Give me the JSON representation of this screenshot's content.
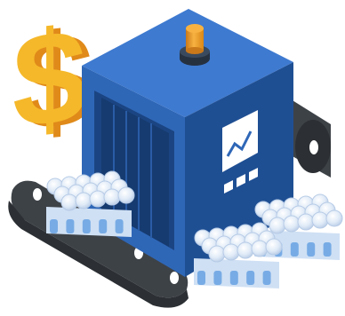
{
  "illustration": {
    "subject": "bottling-production-line",
    "icons": {
      "currency": "dollar-sign-icon",
      "beacon": "warning-beacon-icon",
      "screen": "line-chart-icon"
    },
    "colors": {
      "machine_front": "#2f67b7",
      "machine_side": "#1f4f93",
      "machine_top": "#3e7ad0",
      "belt": "#3d4247",
      "belt_dark": "#2c3034",
      "roller_hole": "#ffffff",
      "dollar_front": "#f5b82a",
      "dollar_side": "#e08a1a",
      "beacon_lamp": "#f0a22c",
      "beacon_base": "#263140",
      "bottle_cap": "#dfeaf7",
      "bottle_cap_edge": "#b7cbe6",
      "bottle_body": "#cfe0f4",
      "bottle_liquid": "#5a9ae0",
      "screen_bg": "#ffffff",
      "screen_line": "#2f67b7"
    }
  }
}
